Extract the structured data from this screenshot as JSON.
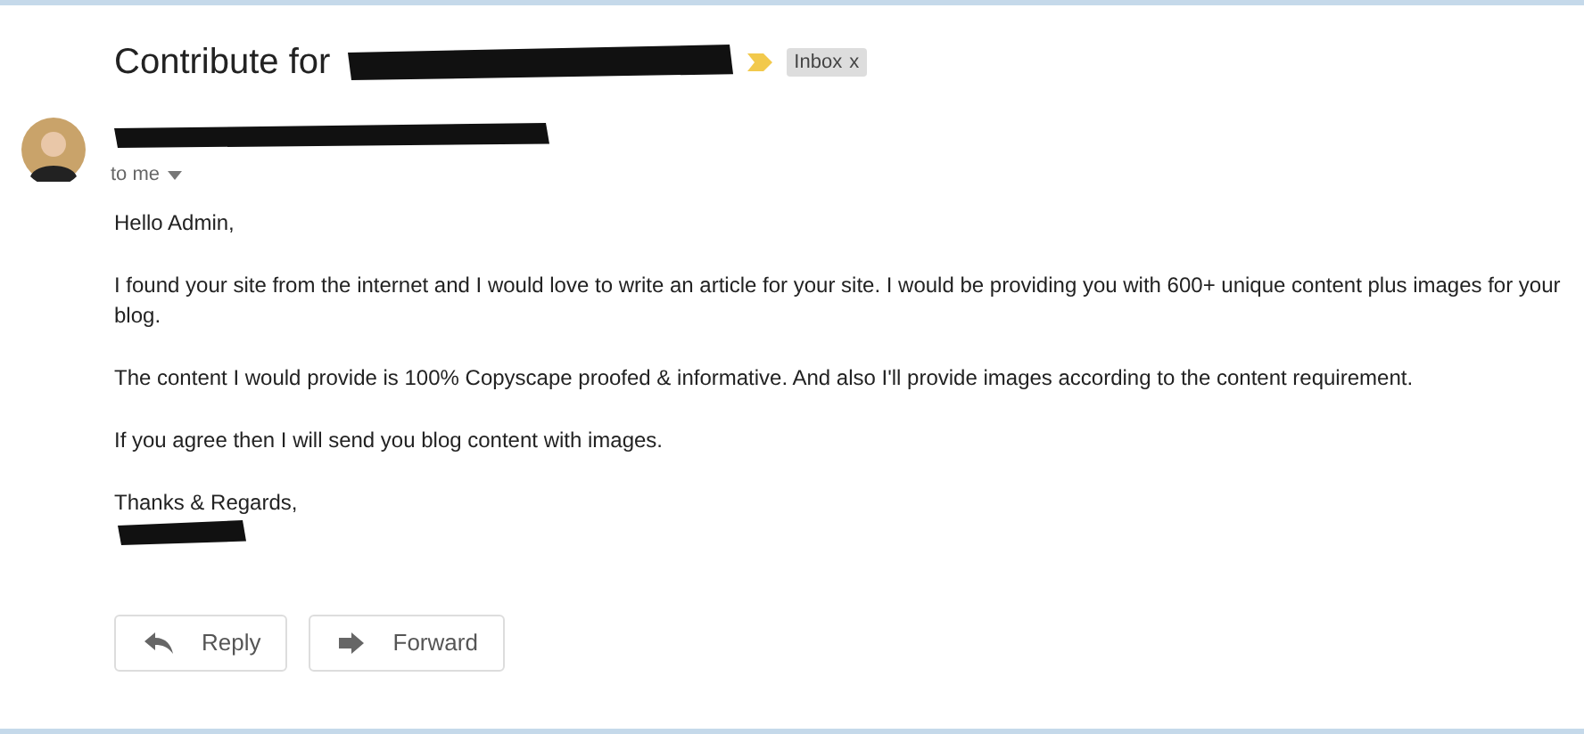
{
  "subject": "Contribute for",
  "label": {
    "text": "Inbox",
    "close": "x"
  },
  "recipient": "to me",
  "body": [
    "Hello Admin,",
    "I found your site from the internet and I would love to write an article for your site. I would be providing you with 600+ unique content plus images for your blog.",
    "The content I would provide is 100% Copyscape proofed & informative. And also I'll provide images according to the content requirement.",
    "If you agree then I will send you blog content with images."
  ],
  "signoff": "Thanks & Regards,",
  "buttons": [
    {
      "kind": "reply",
      "label": "Reply"
    },
    {
      "kind": "forward",
      "label": "Forward"
    }
  ]
}
